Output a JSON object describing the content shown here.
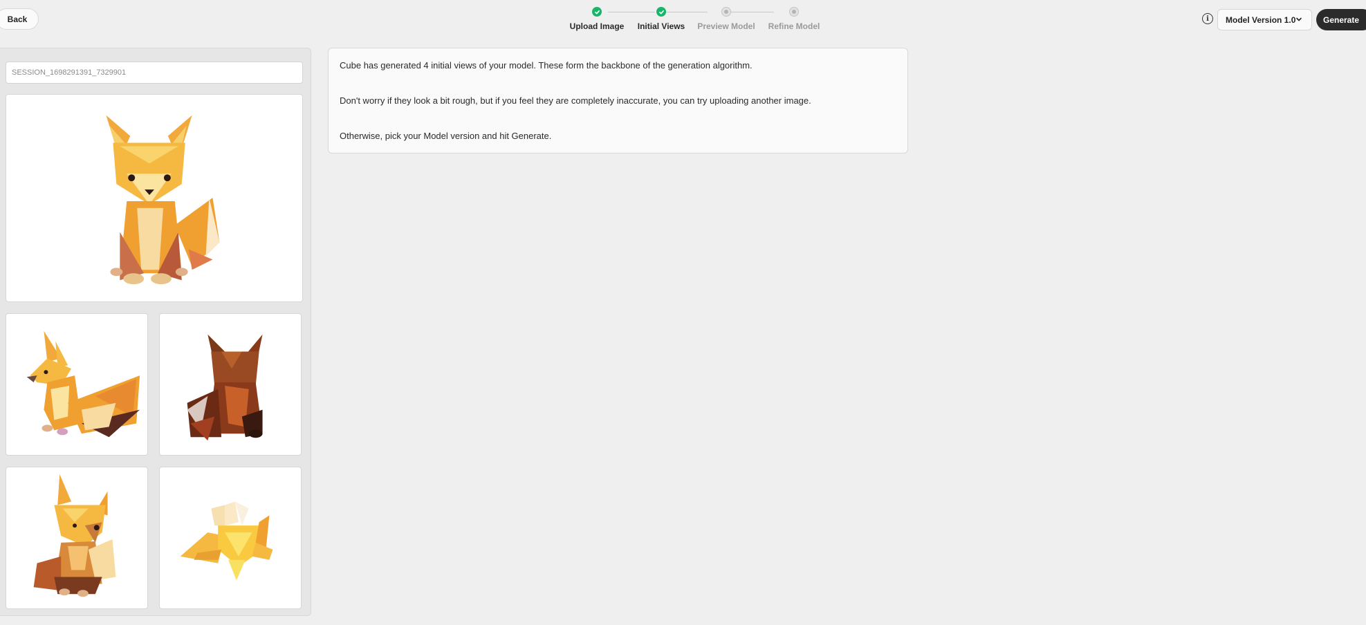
{
  "header": {
    "back_label": "Back",
    "steps": [
      {
        "label": "Upload Image",
        "status": "done"
      },
      {
        "label": "Initial Views",
        "status": "done"
      },
      {
        "label": "Preview Model",
        "status": "todo"
      },
      {
        "label": "Refine Model",
        "status": "todo"
      }
    ],
    "model_version": "Model Version 1.0",
    "generate_label": "Generate",
    "info_icon": "info-icon"
  },
  "sidebar": {
    "session_id": "SESSION_1698291391_7329901",
    "main_view": "fox-front-view",
    "views": [
      "fox-side-view",
      "fox-back-view",
      "fox-three-quarter-view",
      "fox-top-view"
    ]
  },
  "message": {
    "line1": "Cube has generated 4 initial views of your model. These form the backbone of the generation algorithm.",
    "line2": "Don't worry if they look a bit rough, but if you feel they are completely inaccurate, you can try uploading another image.",
    "line3": "Otherwise, pick your Model version and hit Generate."
  },
  "colors": {
    "accent_done": "#19b56b",
    "generate_bg": "#2b2b2b",
    "fox_orange": "#f0a030",
    "fox_dark": "#8a3a1a"
  }
}
